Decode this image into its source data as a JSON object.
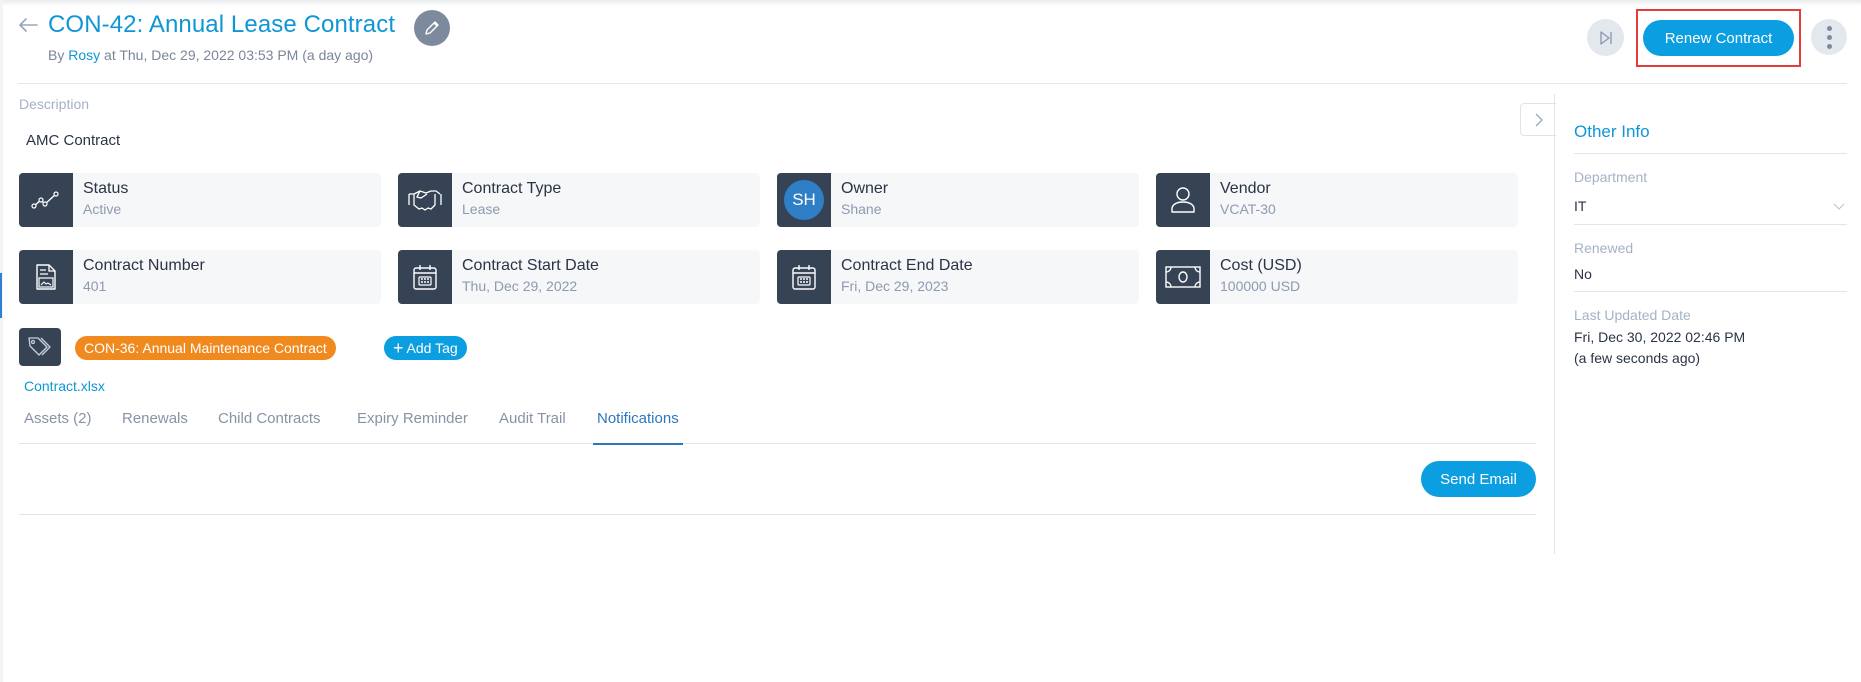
{
  "header": {
    "title": "CON-42: Annual Lease Contract",
    "by_prefix": "By",
    "author": "Rosy",
    "timestamp": "at Thu, Dec 29, 2022 03:53 PM (a day ago)",
    "renew_label": "Renew Contract"
  },
  "main": {
    "description_label": "Description",
    "description_value": "AMC Contract",
    "tiles": [
      {
        "label": "Status",
        "value": "Active",
        "icon": "trend-line-icon"
      },
      {
        "label": "Contract Type",
        "value": "Lease",
        "icon": "handshake-icon"
      },
      {
        "label": "Owner",
        "value": "Shane",
        "icon": "avatar",
        "initials": "SH"
      },
      {
        "label": "Vendor",
        "value": "VCAT-30",
        "icon": "user-icon"
      },
      {
        "label": "Contract Number",
        "value": "401",
        "icon": "contract-document-icon"
      },
      {
        "label": "Contract Start Date",
        "value": "Thu, Dec 29, 2022",
        "icon": "calendar-icon"
      },
      {
        "label": "Contract End Date",
        "value": "Fri, Dec 29, 2023",
        "icon": "calendar-icon"
      },
      {
        "label": "Cost (USD)",
        "value": "100000 USD",
        "icon": "money-icon"
      }
    ],
    "tags": [
      "CON-36: Annual Maintenance Contract"
    ],
    "add_tag_label": "Add Tag",
    "attachment": "Contract.xlsx",
    "tabs": [
      {
        "label": "Assets (2)",
        "active": false
      },
      {
        "label": "Renewals",
        "active": false
      },
      {
        "label": "Child Contracts",
        "active": false
      },
      {
        "label": "Expiry Reminder",
        "active": false
      },
      {
        "label": "Audit Trail",
        "active": false
      },
      {
        "label": "Notifications",
        "active": true
      }
    ],
    "send_email_label": "Send Email"
  },
  "sidebar": {
    "title": "Other Info",
    "department_label": "Department",
    "department_value": "IT",
    "renewed_label": "Renewed",
    "renewed_value": "No",
    "last_updated_label": "Last Updated Date",
    "last_updated_value": "Fri, Dec 30, 2022 02:46 PM",
    "last_updated_relative": "(a few seconds ago)"
  },
  "colors": {
    "accent": "#0b9ee0",
    "tag": "#f08a1f",
    "tile_icon_bg": "#354355",
    "highlight": "#e43b3b"
  }
}
